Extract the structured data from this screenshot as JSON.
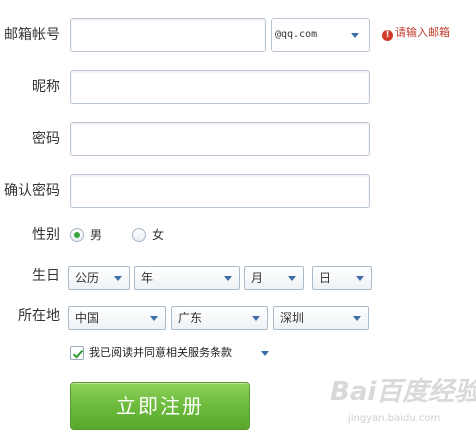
{
  "form": {
    "email": {
      "label": "邮箱帐号",
      "value": "",
      "domain": "@qq.com",
      "error": "请输入邮箱"
    },
    "nickname": {
      "label": "昵称",
      "value": ""
    },
    "password": {
      "label": "密码",
      "value": ""
    },
    "confirm_password": {
      "label": "确认密码",
      "value": ""
    },
    "gender": {
      "label": "性别",
      "options": [
        "男",
        "女"
      ],
      "selected": "男"
    },
    "birthday": {
      "label": "生日",
      "calendar": "公历",
      "year": "年",
      "month": "月",
      "day": "日"
    },
    "location": {
      "label": "所在地",
      "country": "中国",
      "province": "广东",
      "city": "深圳"
    },
    "agreement": {
      "text": "我已阅读并同意相关服务条款",
      "checked": true
    },
    "submit_label": "立即注册"
  },
  "watermark": {
    "main": "Bai百度经验",
    "sub": "jingyan.baidu.com"
  },
  "colors": {
    "accent_green": "#6cbb3c",
    "error_red": "#d23a2a",
    "input_border": "#b9c6d3"
  }
}
